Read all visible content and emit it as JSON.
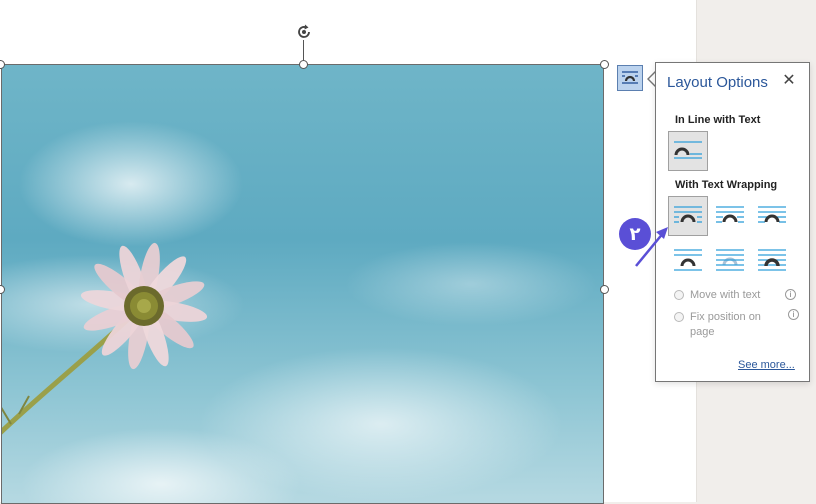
{
  "panel": {
    "title": "Layout Options",
    "close_symbol": "✕",
    "inline_section": "In Line with Text",
    "wrapping_section": "With Text Wrapping",
    "move_with_text": "Move with text",
    "fix_position": "Fix position on page",
    "see_more": "See more...",
    "info_symbol": "i"
  },
  "annotation": {
    "step": "۲",
    "color": "#5a4fd6"
  },
  "icons": {
    "rotate": "rotate-handle-icon",
    "layout_options": "layout-options-icon",
    "inline": "inline-with-text-icon",
    "square": "wrap-square-icon",
    "tight": "wrap-tight-icon",
    "through": "wrap-through-icon",
    "top_bottom": "wrap-top-bottom-icon",
    "behind": "behind-text-icon",
    "front": "in-front-of-text-icon"
  },
  "colors": {
    "accent": "#2b579a",
    "line_blue": "#2e9fd9",
    "shape": "#333333"
  }
}
